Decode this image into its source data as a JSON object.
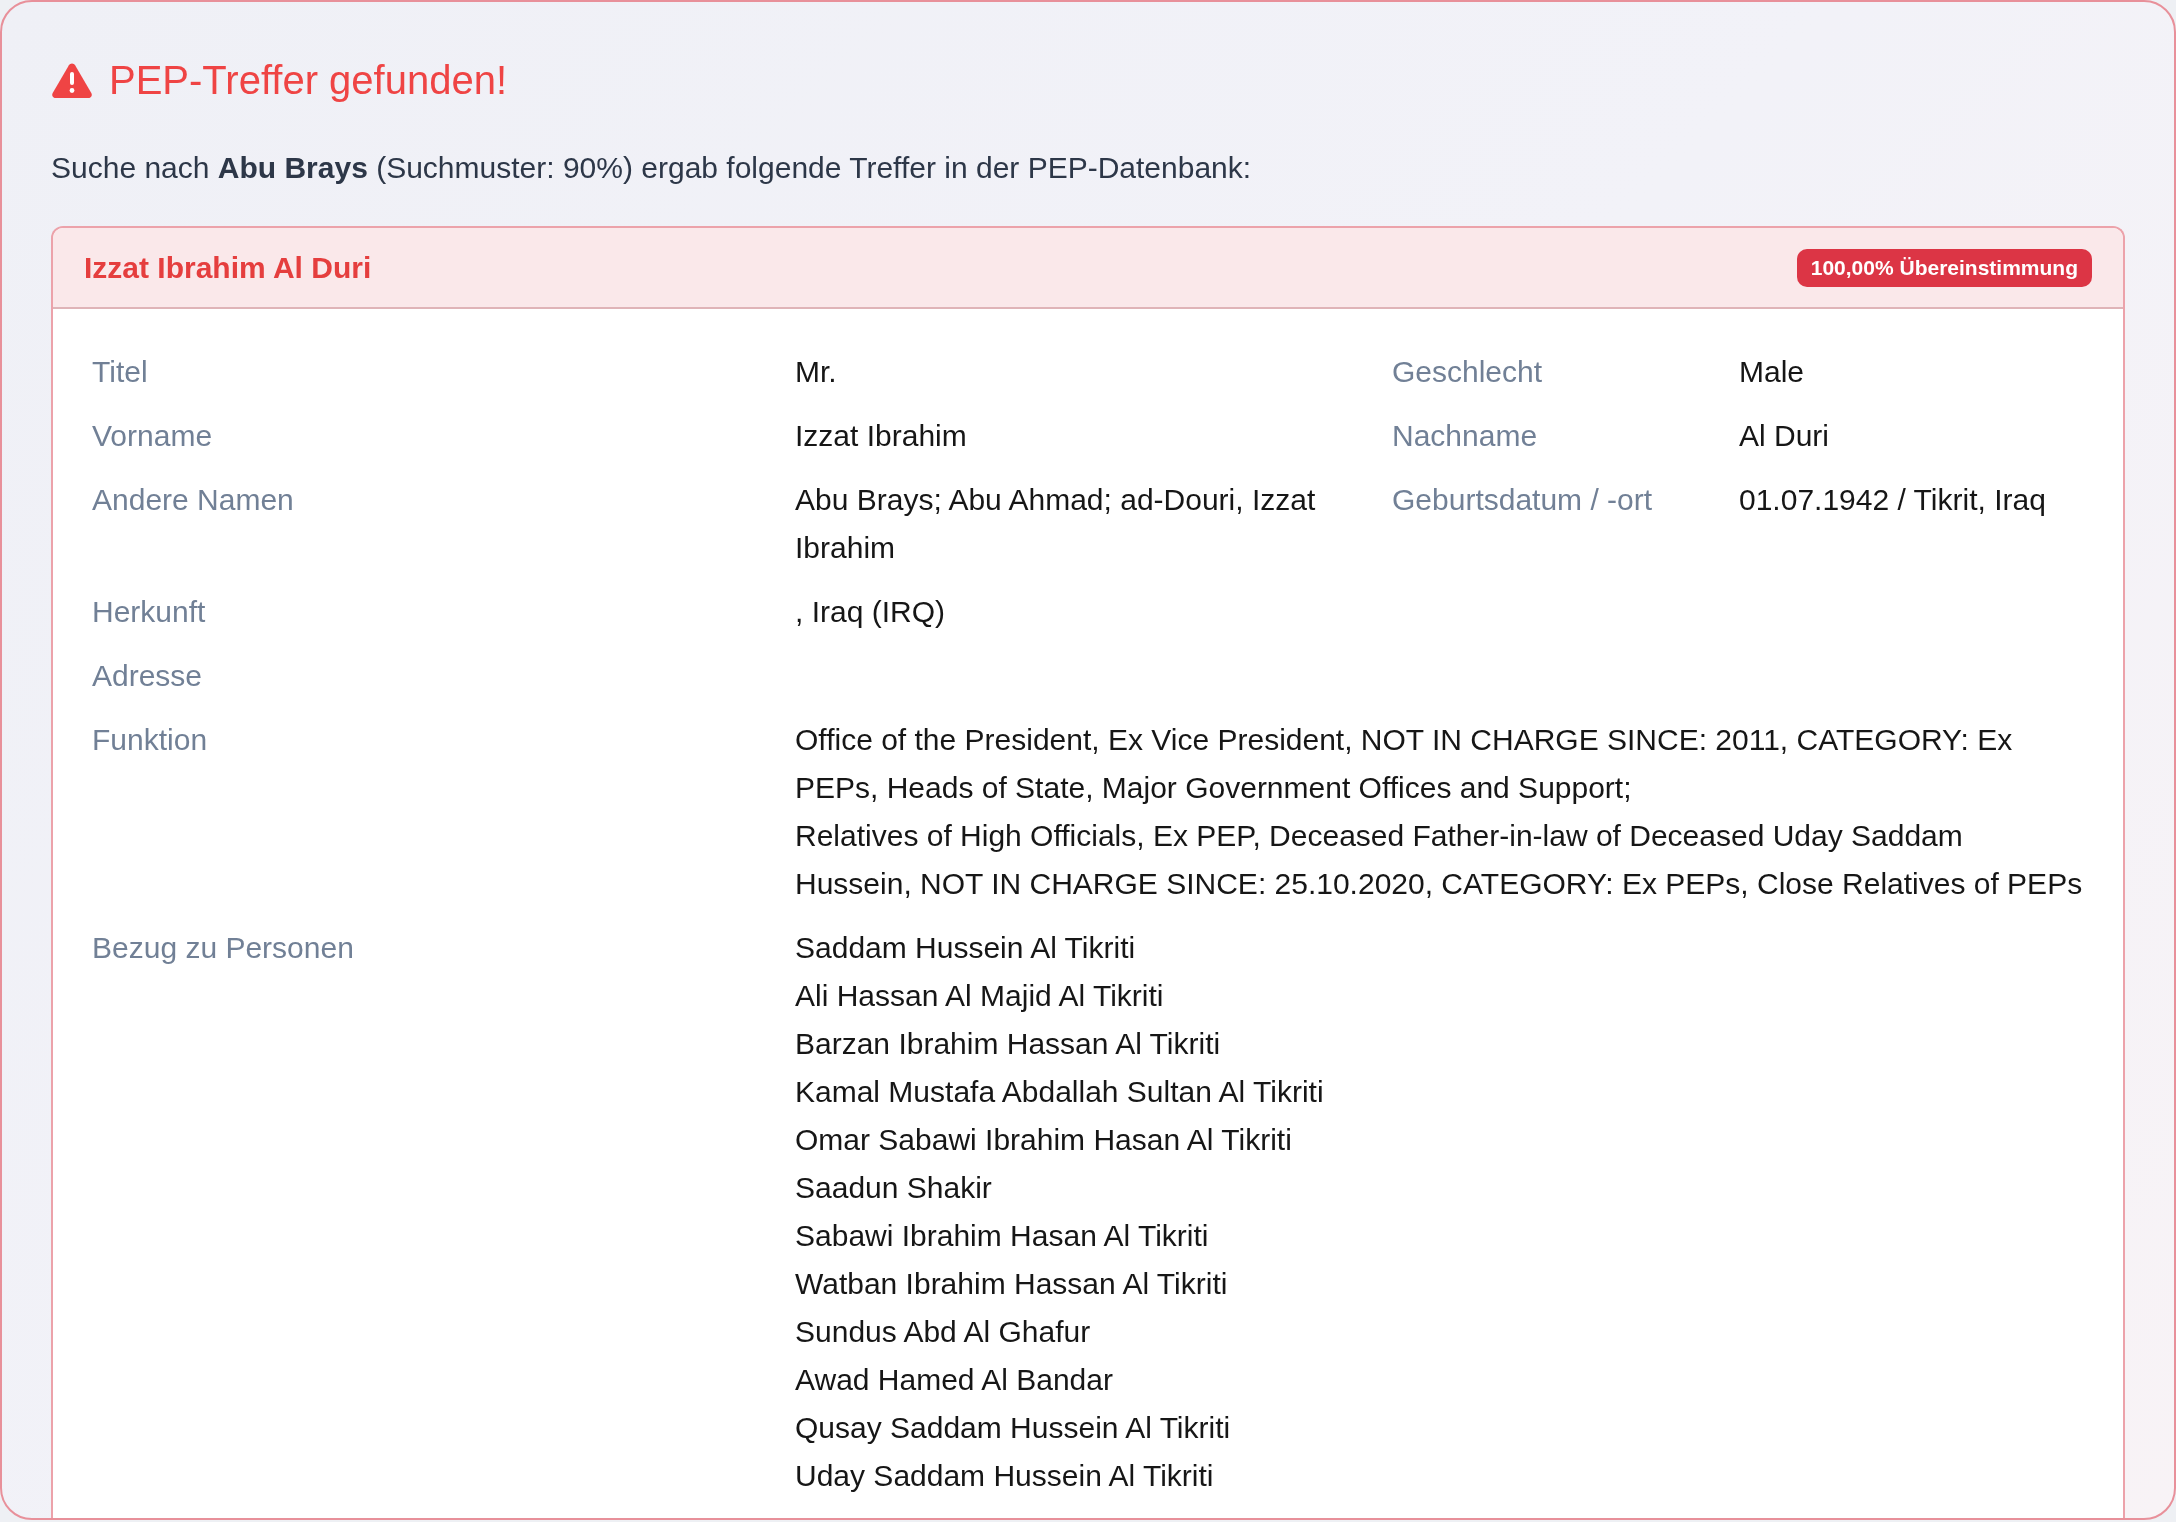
{
  "alert": {
    "title": "PEP-Treffer gefunden!",
    "summary": "Suche nach **Abu Brays** (Suchmuster: 90%) ergab folgende Treffer in der PEP-Datenbank:"
  },
  "matches": [
    {
      "name": "Izzat Ibrahim Al Duri",
      "badge": "100,00% Übereinstimmung",
      "rows": [
        {
          "kind": "fields",
          "fields": [
            {
              "label": "Titel",
              "value": "Mr."
            },
            {
              "label": "Geschlecht",
              "value": "Male"
            }
          ]
        },
        {
          "kind": "fields",
          "fields": [
            {
              "label": "Vorname",
              "value": "Izzat Ibrahim"
            },
            {
              "label": "Nachname",
              "value": "Al Duri"
            }
          ]
        },
        {
          "kind": "fields",
          "fields": [
            {
              "label": "Andere Namen",
              "value": "Abu Brays; Abu Ahmad; ad-Douri, Izzat Ibrahim"
            },
            {
              "label": "Geburtsdatum / -ort",
              "value": "01.07.1942 / Tikrit, Iraq"
            }
          ]
        },
        {
          "kind": "fields",
          "fields": [
            {
              "label": "Herkunft",
              "value": ", Iraq (IRQ)"
            }
          ]
        },
        {
          "kind": "fields",
          "fields": [
            {
              "label": "Adresse"
            }
          ]
        },
        {
          "kind": "text",
          "label": "Funktion",
          "lines": [
            "Office of the President, Ex Vice President, NOT IN CHARGE SINCE: 2011, CATEGORY: Ex PEPs, Heads of State, Major Government Offices and Support;",
            "Relatives of High Officials, Ex PEP, Deceased Father-in-law of Deceased Uday Saddam Hussein, NOT IN CHARGE SINCE: 25.10.2020, CATEGORY: Ex PEPs, Close Relatives of PEPs"
          ]
        },
        {
          "kind": "list",
          "label": "Bezug zu Personen",
          "lines": [
            "Saddam Hussein Al Tikriti",
            "Ali Hassan Al Majid Al Tikriti",
            "Barzan Ibrahim Hassan Al Tikriti",
            "Kamal Mustafa Abdallah Sultan Al Tikriti",
            "Omar Sabawi Ibrahim Hasan Al Tikriti",
            "Saadun Shakir",
            "Sabawi Ibrahim Hasan Al Tikriti",
            "Watban Ibrahim Hassan Al Tikriti",
            "Sundus Abd Al Ghafur",
            "Awad Hamed Al Bandar",
            "Qusay Saddam Hussein Al Tikriti",
            "Uday Saddam Hussein Al Tikriti"
          ]
        }
      ]
    }
  ]
}
